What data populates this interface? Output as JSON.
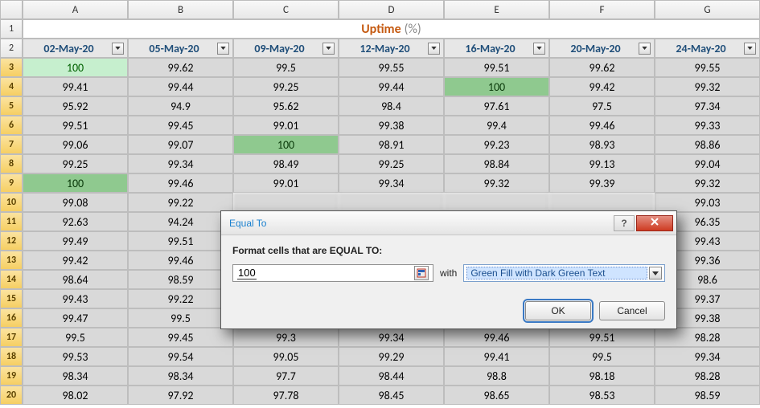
{
  "title": {
    "main": "Uptime",
    "unit": "(%)"
  },
  "columns": [
    "A",
    "B",
    "C",
    "D",
    "E",
    "F",
    "G"
  ],
  "headers": [
    "02-May-20",
    "05-May-20",
    "09-May-20",
    "12-May-20",
    "16-May-20",
    "20-May-20",
    "24-May-20"
  ],
  "rowNums": [
    1,
    2,
    3,
    4,
    5,
    6,
    7,
    8,
    9,
    10,
    11,
    12,
    13,
    14,
    15,
    16,
    17,
    18,
    19,
    20
  ],
  "selectedRows": [
    3,
    4,
    5,
    6,
    7,
    8,
    9,
    10,
    11,
    12,
    13,
    14,
    15,
    16,
    17,
    18,
    19,
    20
  ],
  "rows": [
    {
      "n": 3,
      "v": [
        "100",
        "99.62",
        "99.5",
        "99.55",
        "99.51",
        "99.62",
        "99.55"
      ],
      "hl": {
        "0": "green-light"
      }
    },
    {
      "n": 4,
      "v": [
        "99.41",
        "99.44",
        "99.25",
        "99.44",
        "100",
        "99.42",
        "99.32"
      ],
      "hl": {
        "4": "green-dark"
      }
    },
    {
      "n": 5,
      "v": [
        "95.92",
        "94.9",
        "95.62",
        "98.4",
        "97.61",
        "97.5",
        "97.34"
      ]
    },
    {
      "n": 6,
      "v": [
        "99.51",
        "99.45",
        "99.01",
        "99.38",
        "99.4",
        "99.46",
        "99.33"
      ]
    },
    {
      "n": 7,
      "v": [
        "99.06",
        "99.07",
        "100",
        "98.91",
        "99.23",
        "98.93",
        "98.86"
      ],
      "hl": {
        "2": "green-dark"
      }
    },
    {
      "n": 8,
      "v": [
        "99.25",
        "99.34",
        "98.49",
        "99.25",
        "98.84",
        "99.13",
        "99.04"
      ]
    },
    {
      "n": 9,
      "v": [
        "100",
        "99.46",
        "99.01",
        "99.34",
        "99.32",
        "99.39",
        "99.32"
      ],
      "hl": {
        "0": "green-dark"
      }
    },
    {
      "n": 10,
      "v": [
        "99.08",
        "99.22",
        "",
        "",
        "",
        "",
        "99.03"
      ]
    },
    {
      "n": 11,
      "v": [
        "92.63",
        "94.24",
        "",
        "",
        "",
        "",
        "96.35"
      ]
    },
    {
      "n": 12,
      "v": [
        "99.49",
        "99.51",
        "",
        "",
        "",
        "",
        "99.43"
      ]
    },
    {
      "n": 13,
      "v": [
        "99.42",
        "99.46",
        "",
        "",
        "",
        "",
        "99.36"
      ]
    },
    {
      "n": 14,
      "v": [
        "98.64",
        "98.59",
        "",
        "",
        "",
        "",
        "98.6"
      ]
    },
    {
      "n": 15,
      "v": [
        "99.43",
        "99.22",
        "",
        "",
        "",
        "",
        "99.37"
      ]
    },
    {
      "n": 16,
      "v": [
        "99.47",
        "99.5",
        "",
        "",
        "",
        "",
        "99.38"
      ]
    },
    {
      "n": 17,
      "v": [
        "99.5",
        "99.45",
        "99.3",
        "99.34",
        "99.46",
        "99.51",
        "98.28"
      ]
    },
    {
      "n": 18,
      "v": [
        "99.53",
        "99.54",
        "99.05",
        "99.29",
        "99.41",
        "99.5",
        "99.34"
      ]
    },
    {
      "n": 19,
      "v": [
        "98.34",
        "98.34",
        "97.7",
        "98.44",
        "98.8",
        "98.18",
        "98.28"
      ]
    },
    {
      "n": 20,
      "v": [
        "98.02",
        "97.92",
        "97.78",
        "98.45",
        "98.65",
        "98.53",
        "98.59"
      ]
    }
  ],
  "dialog": {
    "title": "Equal To",
    "prompt": "Format cells that are EQUAL TO:",
    "value": "100",
    "with": "with",
    "formatOption": "Green Fill with Dark Green Text",
    "ok": "OK",
    "cancel": "Cancel",
    "help": "?"
  }
}
